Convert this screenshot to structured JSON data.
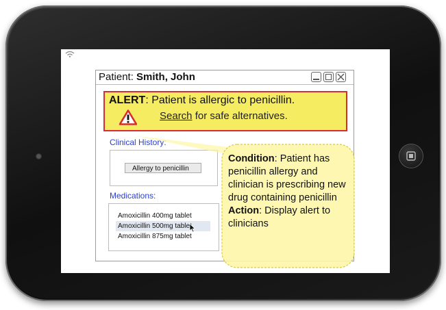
{
  "window": {
    "title_prefix": "Patient:",
    "patient_name": "Smith, John"
  },
  "alert": {
    "heading": "ALERT",
    "message": ": Patient is allergic to penicillin.",
    "link_label": "Search",
    "link_suffix": " for safe alternatives."
  },
  "clinical_history": {
    "label": "Clinical History:",
    "items": [
      "Allergy to penicillin"
    ]
  },
  "medications": {
    "label": "Medications:",
    "items": [
      "Amoxicillin 400mg tablet",
      "Amoxicillin 500mg tablet",
      "Amoxicillin 875mg tablet"
    ],
    "selected": "Amoxicillin 500mg tablet"
  },
  "callout": {
    "condition_label": "Condition",
    "condition_text": ": Patient has penicillin allergy and clinician is prescribing new drug containing penicillin",
    "action_label": "Action",
    "action_text": ": Display alert to clinicians"
  },
  "icons": {
    "warning": "warning-triangle-icon",
    "wifi": "wifi-icon",
    "cursor": "mouse-cursor-icon",
    "home": "home-button-icon"
  },
  "colors": {
    "alert_background": "#f6ec61",
    "alert_border": "#d62e2e",
    "section_label": "#2a3fd0",
    "callout_fill": "#fdf6a6",
    "callout_border": "#d9cb3a"
  }
}
